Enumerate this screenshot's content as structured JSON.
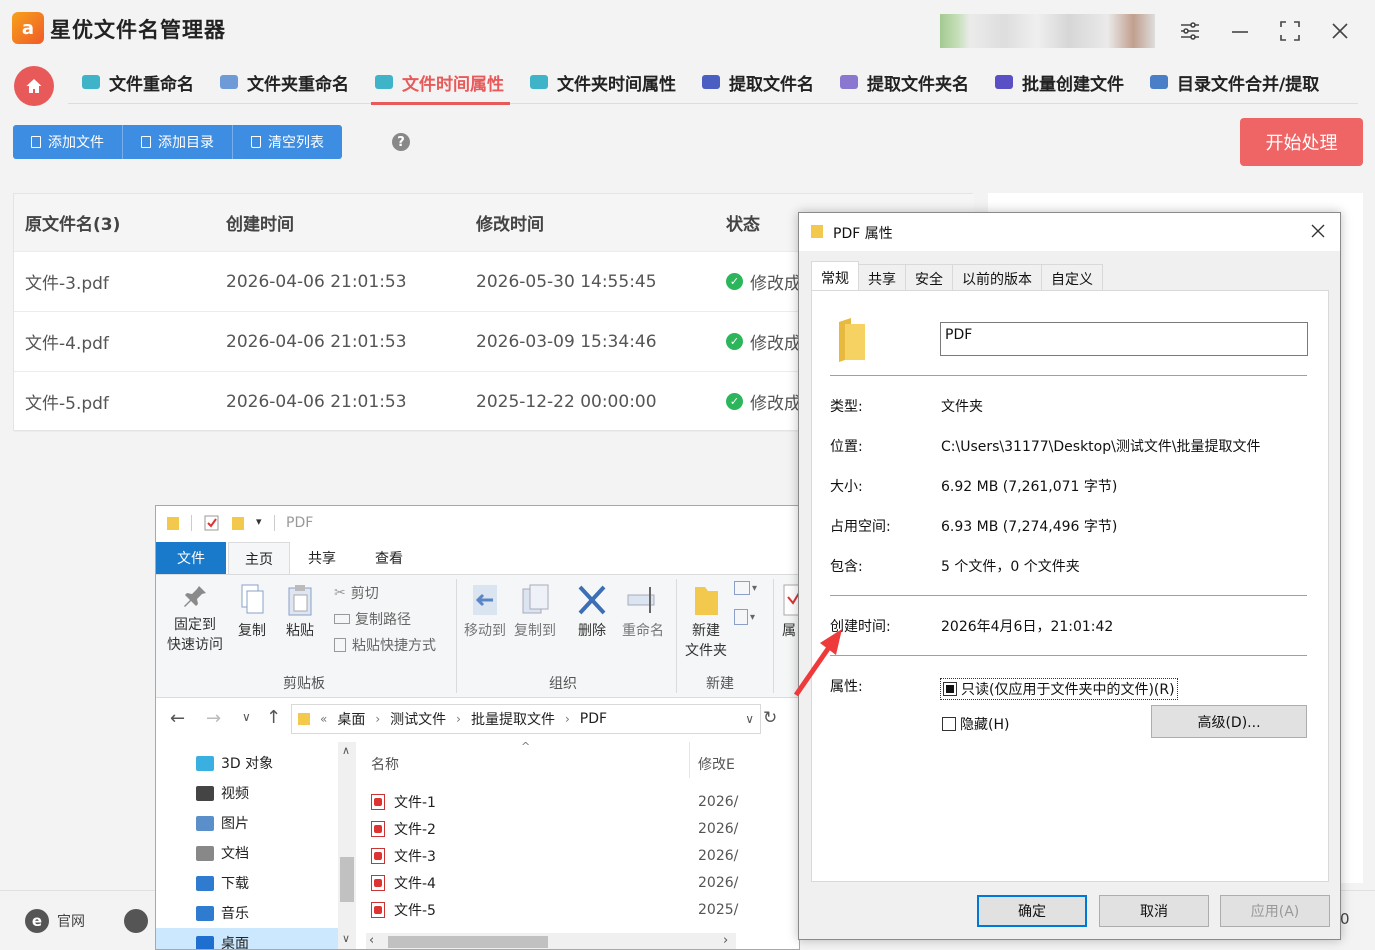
{
  "app": {
    "logo_text": "a",
    "title": "星优文件名管理器"
  },
  "nav": {
    "tabs": [
      {
        "label": "文件重命名",
        "color": "#3fb4c8"
      },
      {
        "label": "文件夹重命名",
        "color": "#6f9ad8"
      },
      {
        "label": "文件时间属性",
        "color": "#3fb4c8"
      },
      {
        "label": "文件夹时间属性",
        "color": "#3fb4c8"
      },
      {
        "label": "提取文件名",
        "color": "#4a5fc1"
      },
      {
        "label": "提取文件夹名",
        "color": "#8a78d0"
      },
      {
        "label": "批量创建文件",
        "color": "#5a4fc4"
      },
      {
        "label": "目录文件合并/提取",
        "color": "#4a7fc8"
      }
    ],
    "active_index": 2
  },
  "toolbar": {
    "add_file": "添加文件",
    "add_dir": "添加目录",
    "clear_list": "清空列表",
    "help": "?",
    "start": "开始处理"
  },
  "table": {
    "headers": [
      "原文件名(3)",
      "创建时间",
      "修改时间",
      "状态"
    ],
    "rows": [
      {
        "name": "文件-3.pdf",
        "created": "2026-04-06 21:01:53",
        "modified": "2026-05-30 14:55:45",
        "status": "修改成"
      },
      {
        "name": "文件-4.pdf",
        "created": "2026-04-06 21:01:53",
        "modified": "2026-03-09 15:34:46",
        "status": "修改成"
      },
      {
        "name": "文件-5.pdf",
        "created": "2026-04-06 21:01:53",
        "modified": "2025-12-22 00:00:00",
        "status": "修改成"
      }
    ]
  },
  "footer": {
    "site_label": "官网",
    "right_digit": "0"
  },
  "explorer": {
    "title": "PDF",
    "ribbon_tabs": [
      "文件",
      "主页",
      "共享",
      "查看"
    ],
    "pin": {
      "line1": "固定到",
      "line2": "快速访问"
    },
    "copy": "复制",
    "paste": "粘贴",
    "cut": "剪切",
    "copy_path": "复制路径",
    "paste_shortcut": "粘贴快捷方式",
    "move_to": "移动到",
    "copy_to": "复制到",
    "delete": "删除",
    "rename": "重命名",
    "new_folder": {
      "line1": "新建",
      "line2": "文件夹"
    },
    "props_partial": "属",
    "groups": {
      "clipboard": "剪贴板",
      "organize": "组织",
      "new": "新建"
    },
    "address": [
      "桌面",
      "测试文件",
      "批量提取文件",
      "PDF"
    ],
    "nav_items": [
      "3D 对象",
      "视频",
      "图片",
      "文档",
      "下载",
      "音乐",
      "桌面"
    ],
    "columns": {
      "name": "名称",
      "modified": "修改E"
    },
    "files": [
      {
        "name": "文件-1",
        "date": "2026/"
      },
      {
        "name": "文件-2",
        "date": "2026/"
      },
      {
        "name": "文件-3",
        "date": "2026/"
      },
      {
        "name": "文件-4",
        "date": "2026/"
      },
      {
        "name": "文件-5",
        "date": "2025/"
      }
    ]
  },
  "dialog": {
    "title": "PDF 属性",
    "tabs": [
      "常规",
      "共享",
      "安全",
      "以前的版本",
      "自定义"
    ],
    "name_value": "PDF",
    "type_label": "类型:",
    "type_value": "文件夹",
    "location_label": "位置:",
    "location_value": "C:\\Users\\31177\\Desktop\\测试文件\\批量提取文件",
    "size_label": "大小:",
    "size_value": "6.92 MB (7,261,071 字节)",
    "disk_label": "占用空间:",
    "disk_value": "6.93 MB (7,274,496 字节)",
    "contains_label": "包含:",
    "contains_value": "5 个文件，0 个文件夹",
    "created_label": "创建时间:",
    "created_value": "2026年4月6日，21:01:42",
    "attr_label": "属性:",
    "readonly_label": "只读(仅应用于文件夹中的文件)(R)",
    "hidden_label": "隐藏(H)",
    "advanced": "高级(D)...",
    "ok": "确定",
    "cancel": "取消",
    "apply": "应用(A)"
  },
  "colors": {
    "accent_red": "#e85a5a",
    "button_blue": "#3d8de2",
    "start_red": "#ef6464",
    "success_green": "#2cb55a",
    "arrow_red": "#ee3a3a"
  }
}
